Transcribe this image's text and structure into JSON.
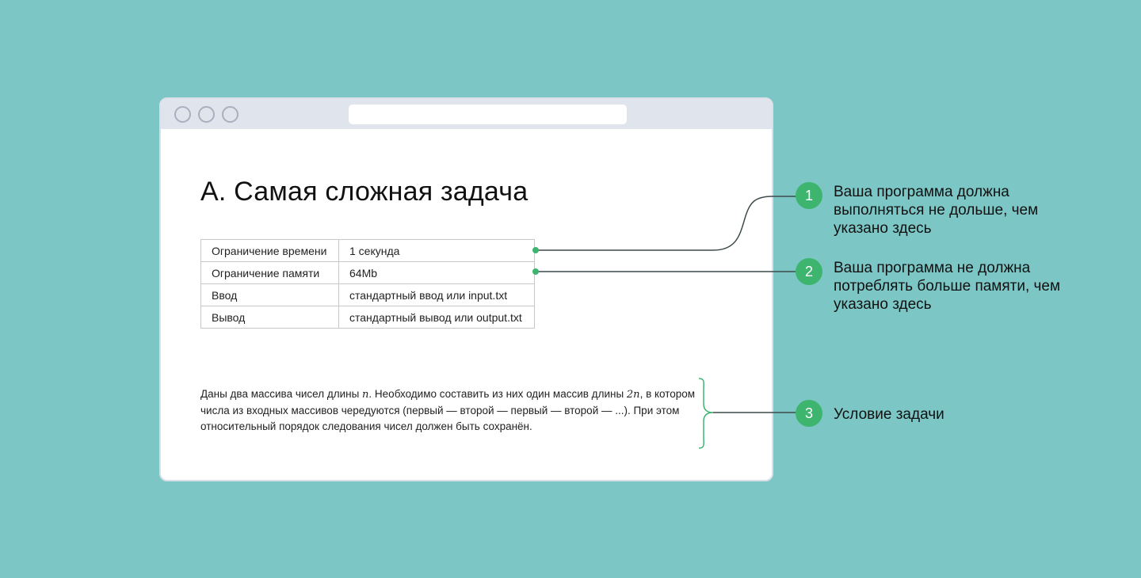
{
  "page": {
    "title": "A. Самая сложная задача",
    "limits": [
      {
        "key": "Ограничение времени",
        "value": "1 секунда"
      },
      {
        "key": "Ограничение памяти",
        "value": "64Mb"
      },
      {
        "key": "Ввод",
        "value": "стандартный ввод или input.txt"
      },
      {
        "key": "Вывод",
        "value": "стандартный вывод или output.txt"
      }
    ],
    "statement": {
      "part1": "Даны два массива чисел длины ",
      "var_n": "n",
      "part2": ". Необходимо составить из них один массив длины ",
      "var_2n": "2n",
      "part3": ", в котором числа из входных массивов чередуются (первый — второй — первый — второй — ...). При этом относительный порядок следования чисел должен быть сохранён."
    }
  },
  "annotations": [
    {
      "number": "1",
      "text": "Ваша программа должна выполняться не дольше, чем указано здесь"
    },
    {
      "number": "2",
      "text": "Ваша программа не должна потреблять больше памяти, чем указано здесь"
    },
    {
      "number": "3",
      "text": "Условие задачи"
    }
  ],
  "colors": {
    "background": "#7cc7c6",
    "accent": "#3db56f",
    "window_chrome": "#e0e4ec"
  }
}
